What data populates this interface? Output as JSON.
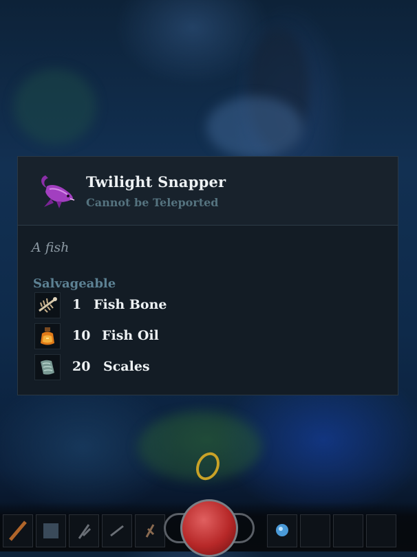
{
  "item": {
    "name": "Twilight Snapper",
    "subtitle": "Cannot be Teleported",
    "description": "A fish",
    "icon": "purple-fish-icon"
  },
  "salvage": {
    "label": "Salvageable",
    "materials": [
      {
        "qty": "1",
        "name": "Fish Bone",
        "icon": "fish-bone-icon"
      },
      {
        "qty": "10",
        "name": "Fish Oil",
        "icon": "fish-oil-icon"
      },
      {
        "qty": "20",
        "name": "Scales",
        "icon": "scales-icon"
      }
    ]
  },
  "colors": {
    "panel_bg": "#131c25",
    "header_bg": "#18222c",
    "subtitle": "#55737f",
    "section_label": "#5d8294",
    "fish_purple": "#a23fc0"
  }
}
